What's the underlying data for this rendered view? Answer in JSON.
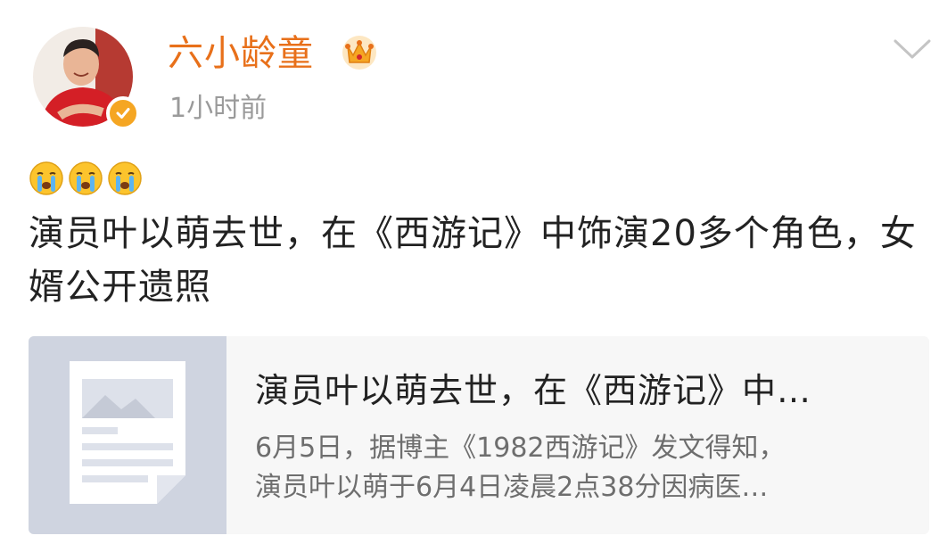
{
  "author": {
    "name": "六小龄童",
    "timestamp": "1小时前",
    "avatar_icon": "avatar-photo",
    "verified_icon": "verified-badge-icon",
    "member_icon": "crown-icon"
  },
  "menu": {
    "icon": "chevron-down-icon"
  },
  "post": {
    "emojis": [
      "crying-face-icon",
      "crying-face-icon",
      "crying-face-icon"
    ],
    "text": "演员叶以萌去世，在《西游记》中饰演20多个角色，女婿公开遗照"
  },
  "link_card": {
    "thumb_icon": "article-icon",
    "title": "演员叶以萌去世，在《西游记》中…",
    "desc_line1": "6月5日，据博主《1982西游记》发文得知，",
    "desc_line2": "演员叶以萌于6月4日凌晨2点38分因病医…"
  },
  "colors": {
    "username": "#e8701a",
    "timestamp": "#9a9a9a",
    "text": "#222222",
    "card_bg": "#f7f7f7",
    "thumb_bg": "#cfd4e0",
    "verified": "#f5a623"
  }
}
